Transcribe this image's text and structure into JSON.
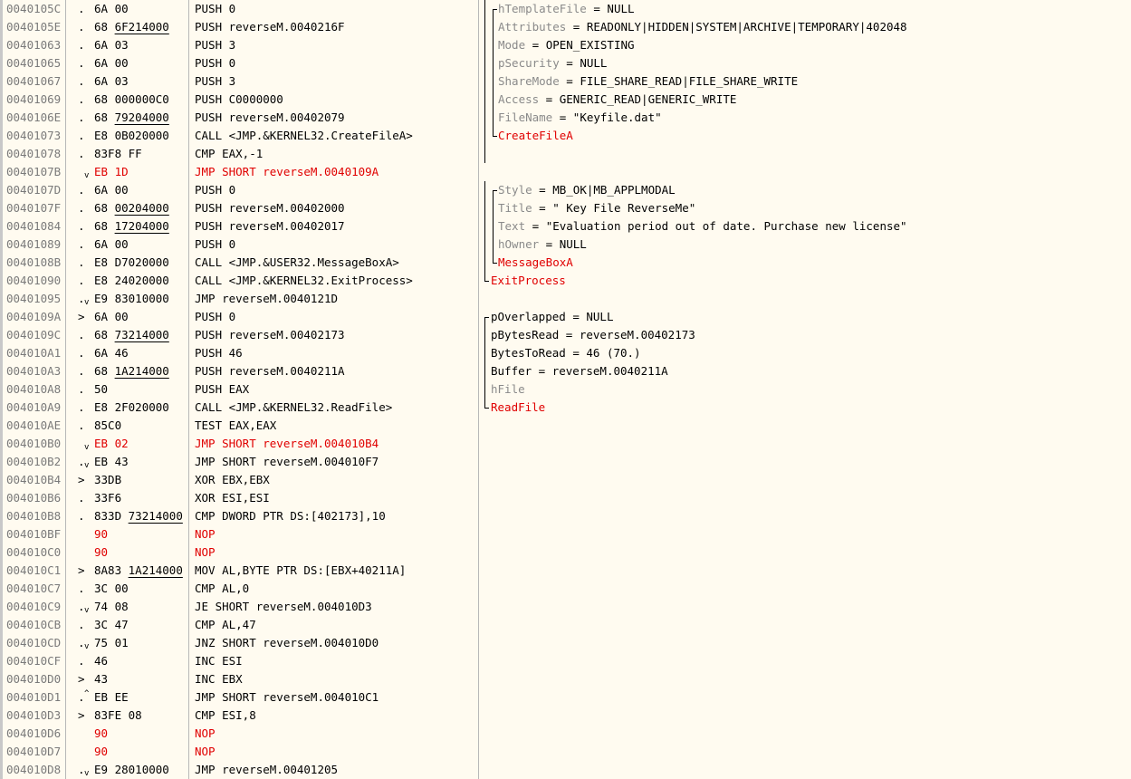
{
  "rows": [
    {
      "addr": "0040105C",
      "mark": ".",
      "b1": "6A",
      "b2": "00",
      "ul": false,
      "dis": "PUSH 0",
      "red": false,
      "arrow": ""
    },
    {
      "addr": "0040105E",
      "mark": ".",
      "b1": "68",
      "b2": "6F214000",
      "ul": true,
      "dis": "PUSH reverseM.0040216F",
      "red": false,
      "arrow": ""
    },
    {
      "addr": "00401063",
      "mark": ".",
      "b1": "6A",
      "b2": "03",
      "ul": false,
      "dis": "PUSH 3",
      "red": false,
      "arrow": ""
    },
    {
      "addr": "00401065",
      "mark": ".",
      "b1": "6A",
      "b2": "00",
      "ul": false,
      "dis": "PUSH 0",
      "red": false,
      "arrow": ""
    },
    {
      "addr": "00401067",
      "mark": ".",
      "b1": "6A",
      "b2": "03",
      "ul": false,
      "dis": "PUSH 3",
      "red": false,
      "arrow": ""
    },
    {
      "addr": "00401069",
      "mark": ".",
      "b1": "68",
      "b2": "000000C0",
      "ul": false,
      "dis": "PUSH C0000000",
      "red": false,
      "arrow": ""
    },
    {
      "addr": "0040106E",
      "mark": ".",
      "b1": "68",
      "b2": "79204000",
      "ul": true,
      "dis": "PUSH reverseM.00402079",
      "red": false,
      "arrow": ""
    },
    {
      "addr": "00401073",
      "mark": ".",
      "b1": "E8",
      "b2": "0B020000",
      "ul": false,
      "dis": "CALL <JMP.&KERNEL32.CreateFileA>",
      "red": false,
      "arrow": ""
    },
    {
      "addr": "00401078",
      "mark": ".",
      "b1": "83F8",
      "b2": "FF",
      "ul": false,
      "dis": "CMP EAX,-1",
      "red": false,
      "arrow": ""
    },
    {
      "addr": "0040107B",
      "mark": "",
      "b1": "EB",
      "b2": "1D",
      "ul": false,
      "dis": "JMP SHORT reverseM.0040109A",
      "red": true,
      "arrow": "down"
    },
    {
      "addr": "0040107D",
      "mark": ".",
      "b1": "6A",
      "b2": "00",
      "ul": false,
      "dis": "PUSH 0",
      "red": false,
      "arrow": ""
    },
    {
      "addr": "0040107F",
      "mark": ".",
      "b1": "68",
      "b2": "00204000",
      "ul": true,
      "dis": "PUSH reverseM.00402000",
      "red": false,
      "arrow": ""
    },
    {
      "addr": "00401084",
      "mark": ".",
      "b1": "68",
      "b2": "17204000",
      "ul": true,
      "dis": "PUSH reverseM.00402017",
      "red": false,
      "arrow": ""
    },
    {
      "addr": "00401089",
      "mark": ".",
      "b1": "6A",
      "b2": "00",
      "ul": false,
      "dis": "PUSH 0",
      "red": false,
      "arrow": ""
    },
    {
      "addr": "0040108B",
      "mark": ".",
      "b1": "E8",
      "b2": "D7020000",
      "ul": false,
      "dis": "CALL <JMP.&USER32.MessageBoxA>",
      "red": false,
      "arrow": ""
    },
    {
      "addr": "00401090",
      "mark": ".",
      "b1": "E8",
      "b2": "24020000",
      "ul": false,
      "dis": "CALL <JMP.&KERNEL32.ExitProcess>",
      "red": false,
      "arrow": ""
    },
    {
      "addr": "00401095",
      "mark": ".",
      "b1": "E9",
      "b2": "83010000",
      "ul": false,
      "dis": "JMP reverseM.0040121D",
      "red": false,
      "arrow": "down"
    },
    {
      "addr": "0040109A",
      "mark": ">",
      "b1": "6A",
      "b2": "00",
      "ul": false,
      "dis": "PUSH 0",
      "red": false,
      "arrow": ""
    },
    {
      "addr": "0040109C",
      "mark": ".",
      "b1": "68",
      "b2": "73214000",
      "ul": true,
      "dis": "PUSH reverseM.00402173",
      "red": false,
      "arrow": ""
    },
    {
      "addr": "004010A1",
      "mark": ".",
      "b1": "6A",
      "b2": "46",
      "ul": false,
      "dis": "PUSH 46",
      "red": false,
      "arrow": ""
    },
    {
      "addr": "004010A3",
      "mark": ".",
      "b1": "68",
      "b2": "1A214000",
      "ul": true,
      "dis": "PUSH reverseM.0040211A",
      "red": false,
      "arrow": ""
    },
    {
      "addr": "004010A8",
      "mark": ".",
      "b1": "50",
      "b2": "",
      "ul": false,
      "dis": "PUSH EAX",
      "red": false,
      "arrow": ""
    },
    {
      "addr": "004010A9",
      "mark": ".",
      "b1": "E8",
      "b2": "2F020000",
      "ul": false,
      "dis": "CALL <JMP.&KERNEL32.ReadFile>",
      "red": false,
      "arrow": ""
    },
    {
      "addr": "004010AE",
      "mark": ".",
      "b1": "85C0",
      "b2": "",
      "ul": false,
      "dis": "TEST EAX,EAX",
      "red": false,
      "arrow": ""
    },
    {
      "addr": "004010B0",
      "mark": "",
      "b1": "EB",
      "b2": "02",
      "ul": false,
      "dis": "JMP SHORT reverseM.004010B4",
      "red": true,
      "arrow": "down"
    },
    {
      "addr": "004010B2",
      "mark": ".",
      "b1": "EB",
      "b2": "43",
      "ul": false,
      "dis": "JMP SHORT reverseM.004010F7",
      "red": false,
      "arrow": "down"
    },
    {
      "addr": "004010B4",
      "mark": ">",
      "b1": "33DB",
      "b2": "",
      "ul": false,
      "dis": "XOR EBX,EBX",
      "red": false,
      "arrow": ""
    },
    {
      "addr": "004010B6",
      "mark": ".",
      "b1": "33F6",
      "b2": "",
      "ul": false,
      "dis": "XOR ESI,ESI",
      "red": false,
      "arrow": ""
    },
    {
      "addr": "004010B8",
      "mark": ".",
      "b1": "833D",
      "b2": "73214000",
      "ul": true,
      "dis": "CMP DWORD PTR DS:[402173],10",
      "red": false,
      "arrow": ""
    },
    {
      "addr": "004010BF",
      "mark": "",
      "b1": "90",
      "b2": "",
      "ul": false,
      "dis": "NOP",
      "red": true,
      "arrow": ""
    },
    {
      "addr": "004010C0",
      "mark": "",
      "b1": "90",
      "b2": "",
      "ul": false,
      "dis": "NOP",
      "red": true,
      "arrow": ""
    },
    {
      "addr": "004010C1",
      "mark": ">",
      "b1": "8A83",
      "b2": "1A214000",
      "ul": true,
      "dis": "MOV AL,BYTE PTR DS:[EBX+40211A]",
      "red": false,
      "arrow": ""
    },
    {
      "addr": "004010C7",
      "mark": ".",
      "b1": "3C",
      "b2": "00",
      "ul": false,
      "dis": "CMP AL,0",
      "red": false,
      "arrow": ""
    },
    {
      "addr": "004010C9",
      "mark": ".",
      "b1": "74",
      "b2": "08",
      "ul": false,
      "dis": "JE SHORT reverseM.004010D3",
      "red": false,
      "arrow": "down"
    },
    {
      "addr": "004010CB",
      "mark": ".",
      "b1": "3C",
      "b2": "47",
      "ul": false,
      "dis": "CMP AL,47",
      "red": false,
      "arrow": ""
    },
    {
      "addr": "004010CD",
      "mark": ".",
      "b1": "75",
      "b2": "01",
      "ul": false,
      "dis": "JNZ SHORT reverseM.004010D0",
      "red": false,
      "arrow": "down"
    },
    {
      "addr": "004010CF",
      "mark": ".",
      "b1": "46",
      "b2": "",
      "ul": false,
      "dis": "INC ESI",
      "red": false,
      "arrow": ""
    },
    {
      "addr": "004010D0",
      "mark": ">",
      "b1": "43",
      "b2": "",
      "ul": false,
      "dis": "INC EBX",
      "red": false,
      "arrow": ""
    },
    {
      "addr": "004010D1",
      "mark": ".",
      "b1": "EB",
      "b2": "EE",
      "ul": false,
      "dis": "JMP SHORT reverseM.004010C1",
      "red": false,
      "arrow": "up"
    },
    {
      "addr": "004010D3",
      "mark": ">",
      "b1": "83FE",
      "b2": "08",
      "ul": false,
      "dis": "CMP ESI,8",
      "red": false,
      "arrow": ""
    },
    {
      "addr": "004010D6",
      "mark": "",
      "b1": "90",
      "b2": "",
      "ul": false,
      "dis": "NOP",
      "red": true,
      "arrow": ""
    },
    {
      "addr": "004010D7",
      "mark": "",
      "b1": "90",
      "b2": "",
      "ul": false,
      "dis": "NOP",
      "red": true,
      "arrow": ""
    },
    {
      "addr": "004010D8",
      "mark": ".",
      "b1": "E9",
      "b2": "28010000",
      "ul": false,
      "dis": "JMP reverseM.00401205",
      "red": false,
      "arrow": "down"
    }
  ],
  "comments": [
    {
      "row": 0,
      "indent": 1,
      "key": "hTemplateFile",
      "val": "NULL",
      "func": ""
    },
    {
      "row": 1,
      "indent": 1,
      "key": "Attributes",
      "val": "READONLY|HIDDEN|SYSTEM|ARCHIVE|TEMPORARY|402048",
      "func": ""
    },
    {
      "row": 2,
      "indent": 1,
      "key": "Mode",
      "val": "OPEN_EXISTING",
      "func": ""
    },
    {
      "row": 3,
      "indent": 1,
      "key": "pSecurity",
      "val": "NULL",
      "func": ""
    },
    {
      "row": 4,
      "indent": 1,
      "key": "ShareMode",
      "val": "FILE_SHARE_READ|FILE_SHARE_WRITE",
      "func": ""
    },
    {
      "row": 5,
      "indent": 1,
      "key": "Access",
      "val": "GENERIC_READ|GENERIC_WRITE",
      "func": ""
    },
    {
      "row": 6,
      "indent": 1,
      "key": "FileName",
      "val": "\"Keyfile.dat\"",
      "func": ""
    },
    {
      "row": 7,
      "indent": 1,
      "key": "",
      "val": "",
      "func": "CreateFileA"
    },
    {
      "row": 10,
      "indent": 1,
      "key": "Style",
      "val": "MB_OK|MB_APPLMODAL",
      "func": ""
    },
    {
      "row": 11,
      "indent": 1,
      "key": "Title",
      "val": "\" Key File ReverseMe\"",
      "func": ""
    },
    {
      "row": 12,
      "indent": 1,
      "key": "Text",
      "val": "\"Evaluation period out of date. Purchase new license\"",
      "func": ""
    },
    {
      "row": 13,
      "indent": 1,
      "key": "hOwner",
      "val": "NULL",
      "func": ""
    },
    {
      "row": 14,
      "indent": 1,
      "key": "",
      "val": "",
      "func": "MessageBoxA"
    },
    {
      "row": 15,
      "indent": 0,
      "key": "",
      "val": "",
      "func": "ExitProcess"
    },
    {
      "row": 17,
      "indent": 0,
      "key": "pOverlapped",
      "val": "NULL",
      "func": "",
      "dark": true
    },
    {
      "row": 18,
      "indent": 0,
      "key": "pBytesRead",
      "val": "reverseM.00402173",
      "func": "",
      "dark": true
    },
    {
      "row": 19,
      "indent": 0,
      "key": "BytesToRead",
      "val": "46 (70.)",
      "func": "",
      "dark": true
    },
    {
      "row": 20,
      "indent": 0,
      "key": "Buffer",
      "val": "reverseM.0040211A",
      "func": "",
      "dark": true
    },
    {
      "row": 21,
      "indent": 0,
      "key": "hFile",
      "val": "",
      "func": "",
      "dark": false
    },
    {
      "row": 22,
      "indent": 0,
      "key": "",
      "val": "",
      "func": "ReadFile"
    }
  ],
  "colors": {
    "background": "#fffbf0",
    "highlight": "#e00000",
    "address": "#7a7a7a",
    "param_key": "#8a8a8a"
  }
}
